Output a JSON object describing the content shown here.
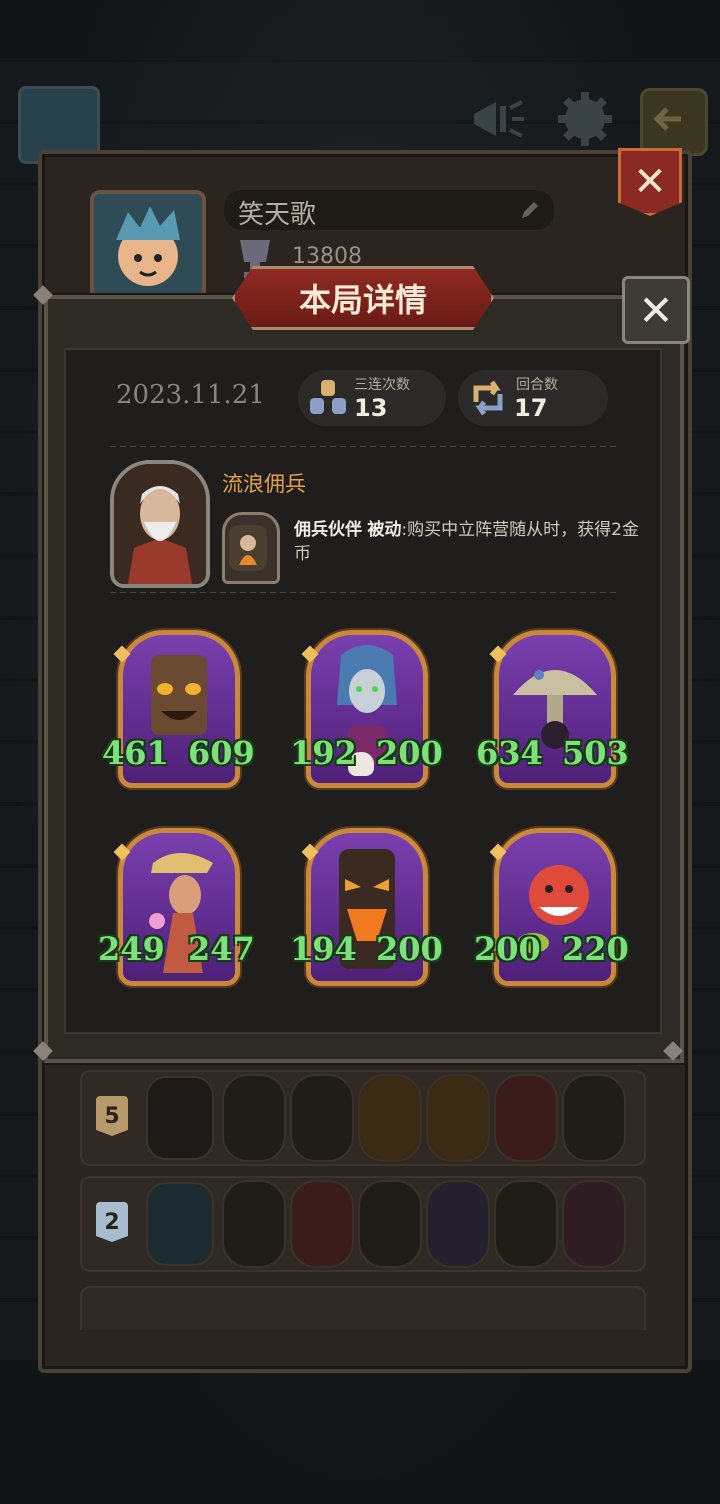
{
  "profile": {
    "name": "笑天歌",
    "rating": "13808"
  },
  "modal": {
    "title": "本局详情",
    "close_symbol": "✕",
    "date": "2023.11.21",
    "triple_label": "三连次数",
    "triple_value": "13",
    "rounds_label": "回合数",
    "rounds_value": "17"
  },
  "hero": {
    "name": "流浪佣兵",
    "skill_name": "佣兵伙伴",
    "skill_type": "被动",
    "skill_desc": ":购买中立阵营随从时，获得2金币"
  },
  "minions": [
    {
      "attack": "461",
      "health": "609",
      "color": "#6a3a9e"
    },
    {
      "attack": "192",
      "health": "200",
      "color": "#5a2c8c"
    },
    {
      "attack": "634",
      "health": "503",
      "color": "#6b3aa0"
    },
    {
      "attack": "249",
      "health": "247",
      "color": "#7040a8"
    },
    {
      "attack": "194",
      "health": "200",
      "color": "#5e2f90"
    },
    {
      "attack": "200",
      "health": "220",
      "color": "#6c3b9c"
    }
  ],
  "history": [
    {
      "rank": "5",
      "rank_color": "#b89a6a"
    },
    {
      "rank": "2",
      "rank_color": "#a8bcd0"
    }
  ],
  "colors": {
    "accent_red": "#8e2a22",
    "stat_green": "#7ee07a",
    "gold_frame": "#c8893e",
    "hero_name": "#e3a14a"
  }
}
